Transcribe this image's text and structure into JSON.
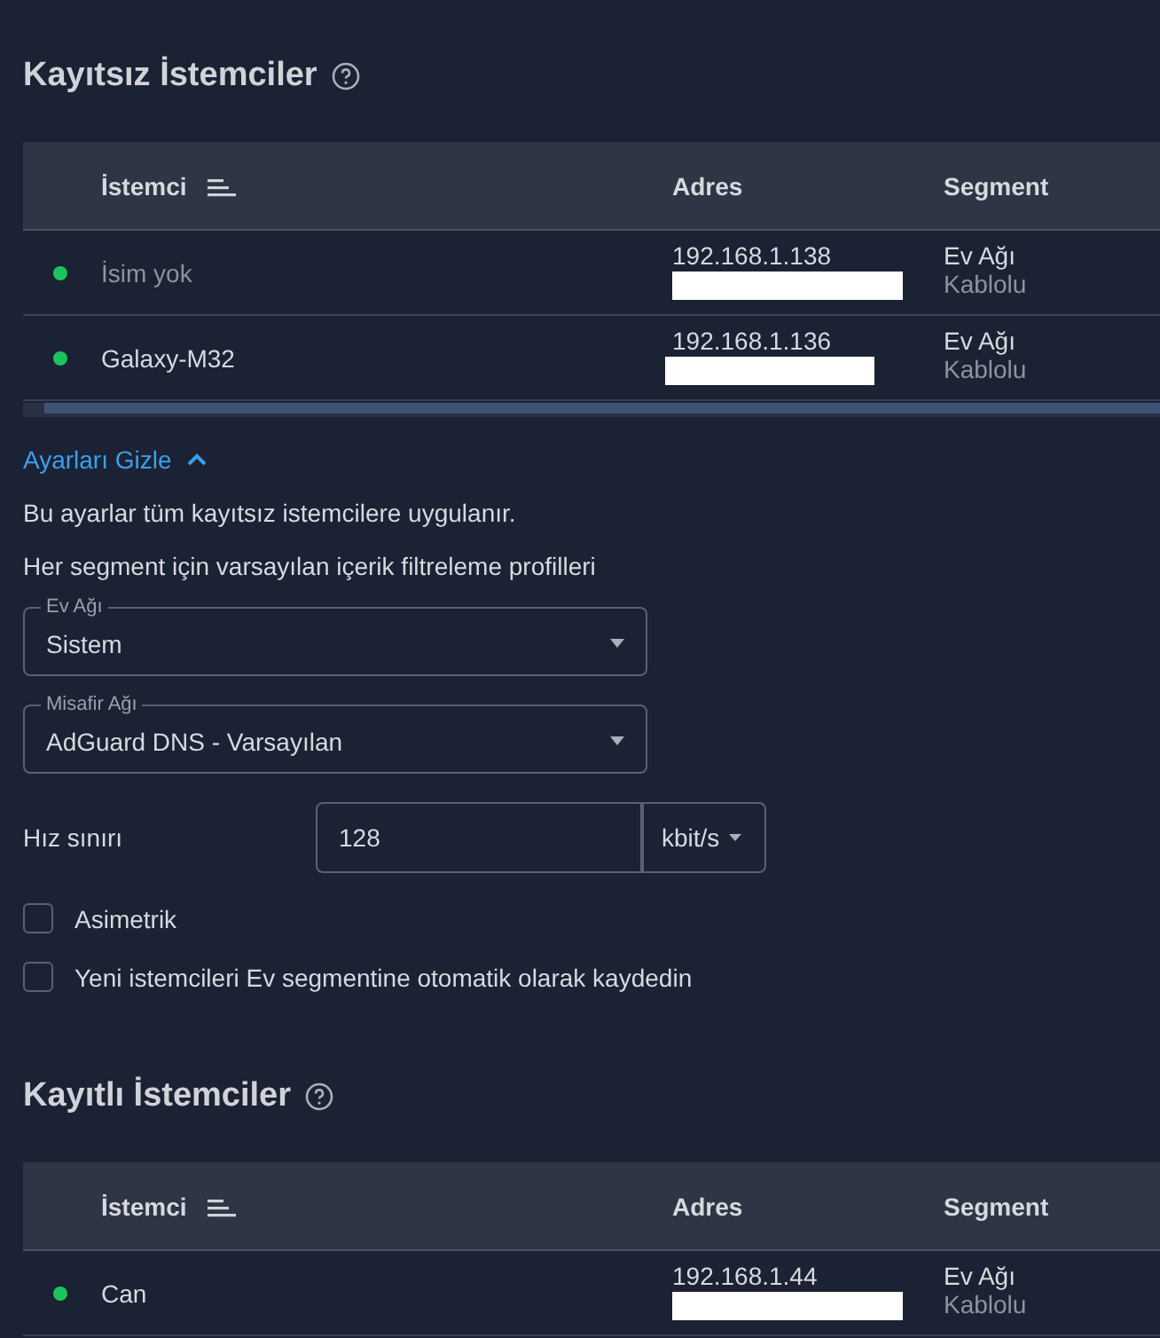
{
  "sections": [
    {
      "title": "Kayıtsız İstemciler",
      "table": {
        "columns": [
          "İstemci",
          "Adres",
          "Segment"
        ],
        "rows": [
          {
            "online": true,
            "unnamed": true,
            "name": "İsim yok",
            "address": "192.168.1.138",
            "segment": "Ev Ağı",
            "connection": "Kablolu"
          },
          {
            "online": true,
            "unnamed": false,
            "name": "Galaxy-M32",
            "address": "192.168.1.136",
            "segment": "Ev Ağı",
            "connection": "Kablolu"
          }
        ]
      },
      "settings": {
        "toggle": "Ayarları Gizle",
        "expanded": true,
        "note": "Bu ayarlar tüm kayıtsız istemcilere uygulanır.",
        "profiles_heading": "Her segment için varsayılan içerik filtreleme profilleri",
        "selects": [
          {
            "label": "Ev Ağı",
            "value": "Sistem"
          },
          {
            "label": "Misafir Ağı",
            "value": "AdGuard DNS - Varsayılan"
          }
        ],
        "speed_limit": {
          "label": "Hız sınırı",
          "value": "128",
          "unit": "kbit/s"
        },
        "checkboxes": [
          {
            "label": "Asimetrik",
            "checked": false
          },
          {
            "label": "Yeni istemcileri Ev segmentine otomatik olarak kaydedin",
            "checked": false
          }
        ]
      }
    },
    {
      "title": "Kayıtlı İstemciler",
      "table": {
        "columns": [
          "İstemci",
          "Adres",
          "Segment"
        ],
        "rows": [
          {
            "online": true,
            "unnamed": false,
            "name": "Can",
            "address": "192.168.1.44",
            "segment": "Ev Ağı",
            "connection": "Kablolu"
          }
        ]
      }
    }
  ]
}
